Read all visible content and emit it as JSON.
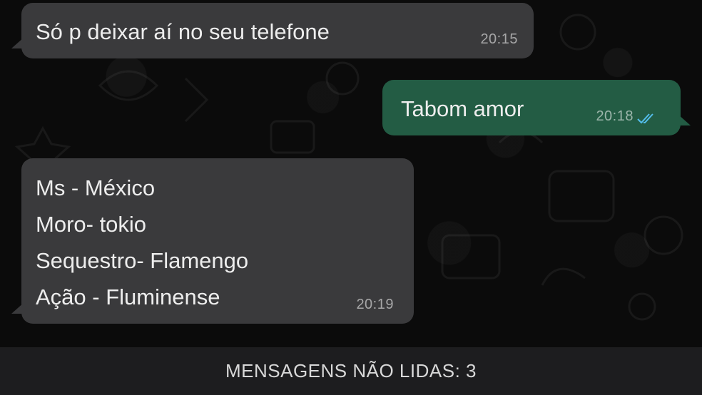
{
  "messages": [
    {
      "direction": "incoming",
      "text": "Só p deixar aí no seu telefone",
      "time": "20:15"
    },
    {
      "direction": "outgoing",
      "text": "Tabom amor",
      "time": "20:18",
      "status_icon": "double-check-icon",
      "status_color": "#53bdeb"
    },
    {
      "direction": "incoming",
      "lines": [
        "Ms - México",
        "Moro- tokio",
        "Sequestro- Flamengo",
        "Ação - Fluminense"
      ],
      "time": "20:19"
    }
  ],
  "unread_banner": {
    "text": "MENSAGENS NÃO LIDAS: 3"
  },
  "colors": {
    "background": "#0b0b0b",
    "incoming_bubble": "#3a3a3c",
    "outgoing_bubble": "#235c44",
    "banner": "#1d1d1f"
  }
}
